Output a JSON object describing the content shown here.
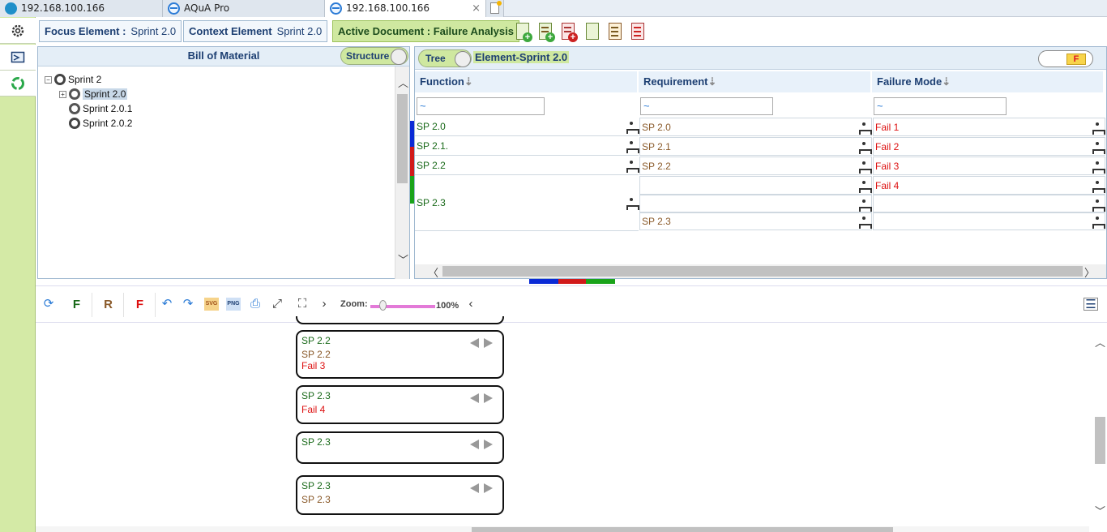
{
  "browser": {
    "tabs": [
      {
        "label": "192.168.100.166",
        "active": false
      },
      {
        "label": "AQuA Pro",
        "active": false
      },
      {
        "label": "192.168.100.166",
        "active": true
      }
    ],
    "close_glyph": "×"
  },
  "sidebar": {
    "items": [
      {
        "icon": "gear-icon"
      },
      {
        "icon": "screen-icon"
      },
      {
        "icon": "recycle-icon"
      }
    ]
  },
  "toolbar": {
    "focus_label": "Focus Element :",
    "focus_value": "Sprint 2.0",
    "context_label": "Context Element",
    "context_value": "Sprint 2.0",
    "active_doc": "Active Document : Failure Analysis"
  },
  "bom": {
    "title": "Bill of Material",
    "structure_toggle": "Structure",
    "tree": [
      {
        "label": "Sprint 2",
        "expander": "⊟"
      },
      {
        "label": "Sprint 2.0",
        "expander": "⊞",
        "selected": true
      },
      {
        "label": "Sprint 2.0.1"
      },
      {
        "label": "Sprint 2.0.2"
      }
    ],
    "scroll_up": "︿",
    "scroll_down": "﹀"
  },
  "analysis": {
    "tree_toggle": "Tree",
    "element_title": "Element-Sprint 2.0",
    "f_toggle": "F",
    "columns": [
      "Function",
      "Requirement",
      "Failure Mode"
    ],
    "sort_glyph": "⇣",
    "filter_value": "~",
    "functions": [
      "SP 2.0",
      "SP 2.1.",
      "SP 2.2",
      "SP 2.3"
    ],
    "requirements": [
      "SP 2.0",
      "SP 2.1",
      "SP 2.2",
      "",
      "",
      "SP 2.3"
    ],
    "failures": [
      "Fail 1",
      "Fail 2",
      "Fail 3",
      "Fail 4",
      "",
      ""
    ],
    "scroll_left": "〈",
    "scroll_right": "〉",
    "colors": {
      "blue": "#0a2ad6",
      "red": "#d11a1a",
      "green": "#1aa31a"
    }
  },
  "graph_toolbar": {
    "buttons": [
      "F",
      "R",
      "F"
    ],
    "button_colors": [
      "#1a6a1a",
      "#8a5a2a",
      "#d11"
    ],
    "zoom_label": "Zoom:",
    "zoom_value": "100%",
    "zoom_fraction": 1.0,
    "more_glyph": "›",
    "less_glyph": "‹"
  },
  "graph": {
    "cards": [
      {
        "function": "SP 2.2",
        "requirement": "SP 2.2",
        "failure": "Fail 3"
      },
      {
        "function": "SP 2.3",
        "requirement": "",
        "failure": "Fail 4"
      },
      {
        "function": "SP 2.3",
        "requirement": "",
        "failure": ""
      },
      {
        "function": "SP 2.3",
        "requirement": "SP 2.3",
        "failure": ""
      }
    ],
    "scroll_up": "︿",
    "scroll_down": "﹀"
  }
}
